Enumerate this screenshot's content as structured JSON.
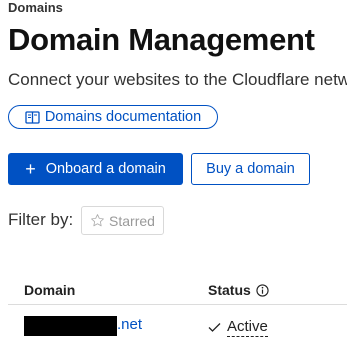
{
  "breadcrumb": "Domains",
  "page_title": "Domain Management",
  "subtitle": "Connect your websites to the Cloudflare network",
  "docs_link": {
    "label": "Domains documentation",
    "icon": "book-icon"
  },
  "actions": {
    "onboard_label": "Onboard a domain",
    "buy_label": "Buy a domain"
  },
  "filter": {
    "label": "Filter by:",
    "chip_label": "Starred"
  },
  "table": {
    "columns": [
      "Domain",
      "Status"
    ],
    "rows": [
      {
        "domain_suffix": ".net",
        "status": "Active"
      }
    ]
  },
  "colors": {
    "accent": "#0051c3",
    "redaction": "#000000"
  }
}
